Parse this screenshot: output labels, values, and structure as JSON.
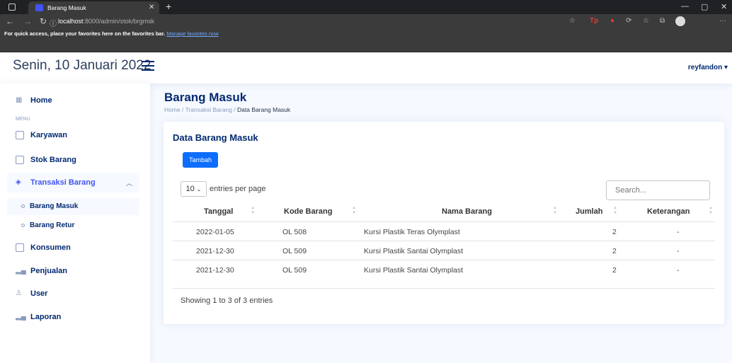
{
  "browser": {
    "tab_title": "Barang Masuk",
    "url_host": "localhost",
    "url_path": ":8000/admin/stok/brgmsk",
    "favbar_text": "For quick access, place your favorites here on the favorites bar.",
    "favbar_link": "Manage favorites now"
  },
  "header": {
    "date": "Senin, 10 Januari 2022",
    "user": "reyfandon ▾"
  },
  "sidebar": {
    "home": "Home",
    "heading": "MENU",
    "items": [
      {
        "label": "Karyawan"
      },
      {
        "label": "Stok Barang"
      },
      {
        "label": "Transaksi Barang"
      },
      {
        "label": "Konsumen"
      },
      {
        "label": "Penjualan"
      },
      {
        "label": "User"
      },
      {
        "label": "Laporan"
      }
    ],
    "sub_items": [
      {
        "label": "Barang Masuk"
      },
      {
        "label": "Barang Retur"
      }
    ]
  },
  "page": {
    "title": "Barang Masuk",
    "breadcrumb_1": "Home",
    "breadcrumb_2": "Transaksi Barang",
    "breadcrumb_3": "Data Barang Masuk"
  },
  "card": {
    "title": "Data Barang Masuk",
    "add_button": "Tambah",
    "per_page_value": "10",
    "per_page_label": "entries per page",
    "search_placeholder": "Search...",
    "showing": "Showing 1 to 3 of 3 entries"
  },
  "table": {
    "headers": [
      "Tanggal",
      "Kode Barang",
      "Nama Barang",
      "Jumlah",
      "Keterangan"
    ],
    "rows": [
      {
        "tanggal": "2022-01-05",
        "kode": "OL 508",
        "nama": "Kursi Plastik Teras Olymplast",
        "jumlah": "2",
        "ket": "-"
      },
      {
        "tanggal": "2021-12-30",
        "kode": "OL 509",
        "nama": "Kursi Plastik Santai Olymplast",
        "jumlah": "2",
        "ket": "-"
      },
      {
        "tanggal": "2021-12-30",
        "kode": "OL 509",
        "nama": "Kursi Plastik Santai Olymplast",
        "jumlah": "2",
        "ket": "-"
      }
    ]
  }
}
